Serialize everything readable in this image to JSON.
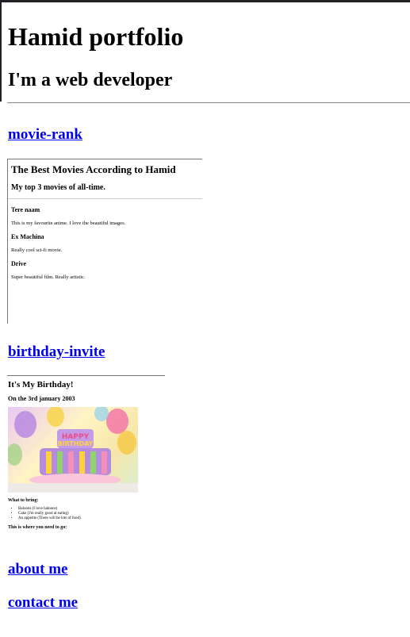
{
  "header": {
    "title": "Hamid portfolio",
    "subtitle": "I'm a web developer"
  },
  "projects": {
    "movie_rank": "movie-rank",
    "birthday_invite": "birthday-invite",
    "about_me": "about me",
    "contact_me": "contact me"
  },
  "movie_frame": {
    "title": "The Best Movies According to Hamid",
    "subtitle": "My top 3 movies of all-time.",
    "movies": [
      {
        "name": "Tere naam",
        "desc": "This is my favourite anime. I love the beautiful images."
      },
      {
        "name": "Ex Machina",
        "desc": "Really cool sci-fi movie."
      },
      {
        "name": "Drive",
        "desc": "Super beautiful film. Really artistic."
      }
    ]
  },
  "birthday_frame": {
    "title": "It's My Birthday!",
    "date": "On the 3rd january 2003",
    "bring_heading": "What to bring:",
    "items": [
      "Baloons (I love baloons)",
      "Cake (I'm really good at eating)",
      "An appetite (There will be lots of food)"
    ],
    "where_heading": "This is where you need to go:"
  }
}
